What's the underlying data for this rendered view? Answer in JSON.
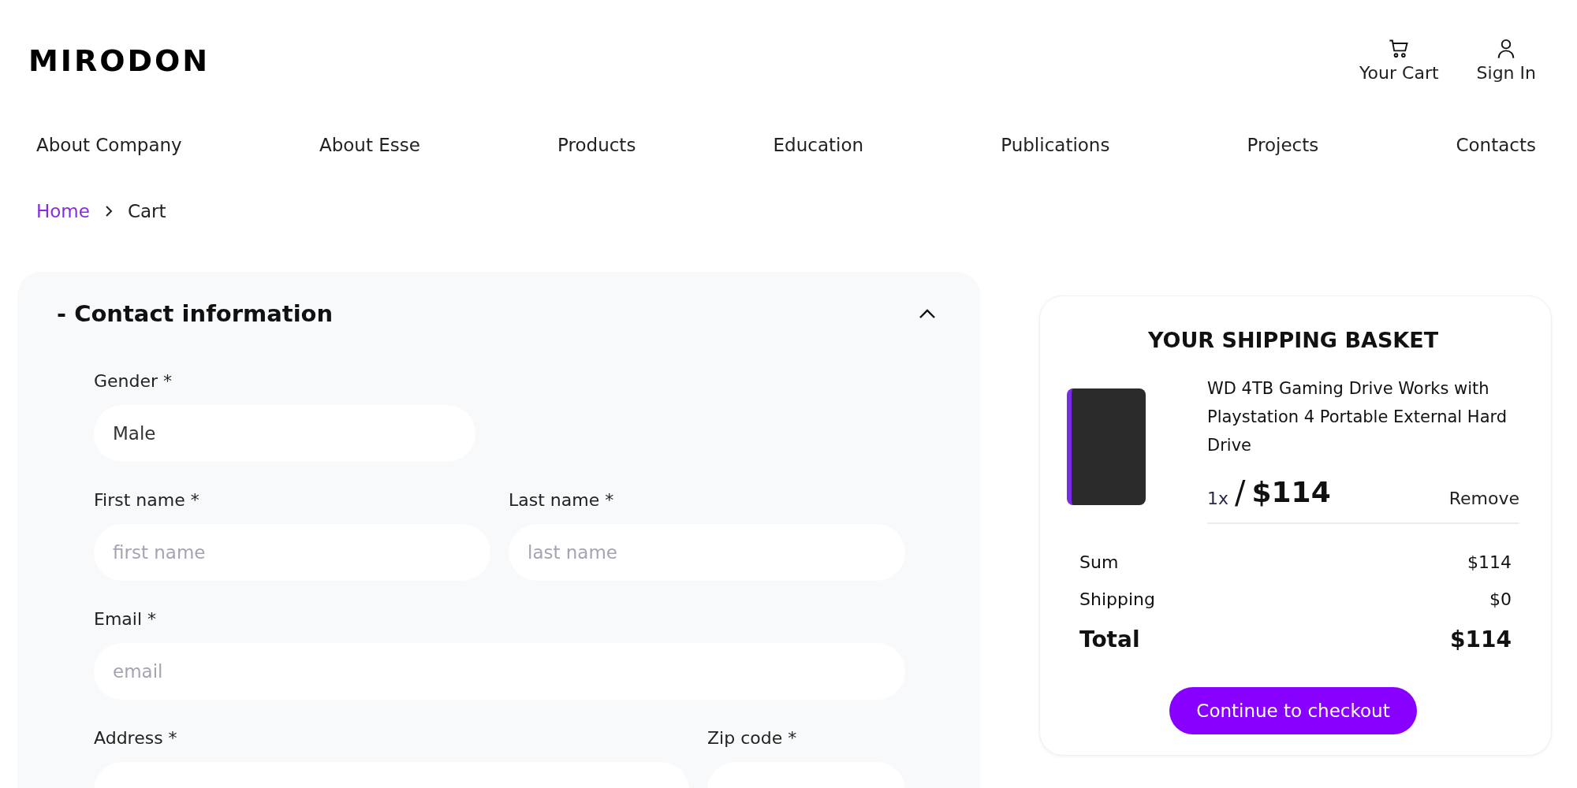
{
  "header": {
    "logo": "MIRODON",
    "actions": [
      {
        "kind": "cart",
        "label": "Your Cart"
      },
      {
        "kind": "user",
        "label": "Sign In"
      }
    ]
  },
  "nav": [
    "About Company",
    "About Esse",
    "Products",
    "Education",
    "Publications",
    "Projects",
    "Contacts"
  ],
  "breadcrumb": [
    {
      "label": "Home",
      "link": true
    },
    {
      "label": "Cart",
      "link": false
    }
  ],
  "contact_section": {
    "title": "- Contact information",
    "expanded": true,
    "rows": [
      [
        {
          "label": "Gender *",
          "value": "Male",
          "kind": "short"
        }
      ],
      [
        {
          "label": "First name *",
          "placeholder": "first name",
          "kind": "fill"
        },
        {
          "label": "Last name *",
          "placeholder": "last name",
          "kind": "fill"
        }
      ],
      [
        {
          "label": "Email *",
          "placeholder": "email",
          "kind": "fill"
        }
      ],
      [
        {
          "label": "Address *",
          "kind": "wide"
        },
        {
          "label": "Zip code *",
          "kind": "fill"
        }
      ]
    ]
  },
  "basket": {
    "title": "YOUR SHIPPING BASKET",
    "items": [
      {
        "name": "WD 4TB Gaming Drive Works with Playstation 4 Portable External Hard Drive",
        "quantity": "1x",
        "separator": "/",
        "price": "$114",
        "remove": "Remove"
      }
    ],
    "summary": [
      {
        "label": "Sum",
        "value": "$114",
        "bold": false
      },
      {
        "label": "Shipping",
        "value": "$0",
        "bold": false
      },
      {
        "label": "Total",
        "value": "$114",
        "bold": true
      }
    ],
    "checkout": "Continue to checkout"
  }
}
